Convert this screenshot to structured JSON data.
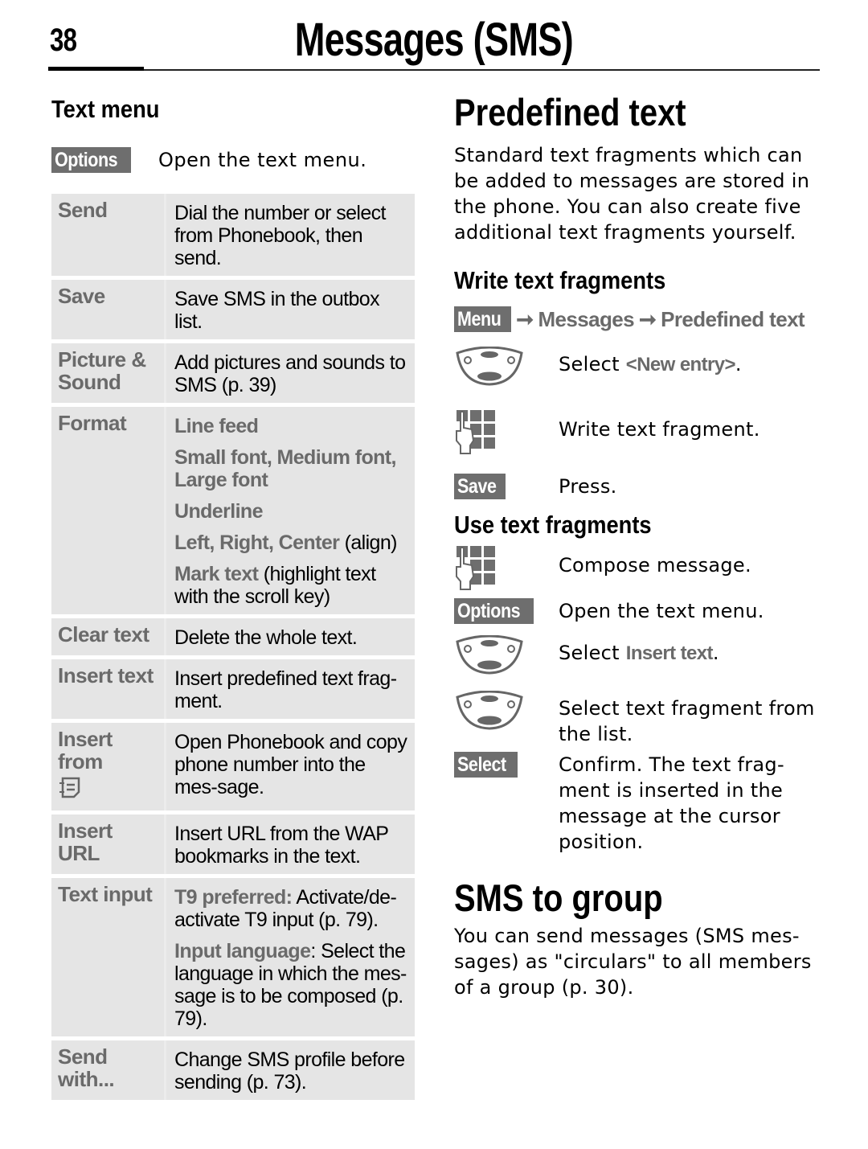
{
  "header": {
    "page_number": "38",
    "chapter_title": "Messages (SMS)"
  },
  "text_menu": {
    "heading": "Text menu",
    "intro": {
      "softkey": "Options",
      "icon": "options-softkey",
      "description": "Open the text menu."
    },
    "rows": [
      {
        "term": [
          "Send"
        ],
        "definition": [
          [
            {
              "t": "Dial the number or select from Phonebook, then send.",
              "hl": false
            }
          ]
        ]
      },
      {
        "term": [
          "Save"
        ],
        "definition": [
          [
            {
              "t": "Save SMS in the outbox list.",
              "hl": false
            }
          ]
        ]
      },
      {
        "term": [
          "Picture &",
          "Sound"
        ],
        "definition": [
          [
            {
              "t": "Add pictures and sounds to SMS (p. 39)",
              "hl": false
            }
          ]
        ]
      },
      {
        "term": [
          "Format"
        ],
        "definition": [
          [
            {
              "t": "Line feed",
              "hl": true
            }
          ],
          [
            {
              "t": "Small font, Medium font, Large font",
              "hl": true
            }
          ],
          [
            {
              "t": "Underline",
              "hl": true
            }
          ],
          [
            {
              "t": "Left, Right, Center",
              "hl": true
            },
            {
              "t": " (align)",
              "hl": false
            }
          ],
          [
            {
              "t": "Mark text",
              "hl": true
            },
            {
              "t": " (highlight text with the scroll key)",
              "hl": false
            }
          ]
        ]
      },
      {
        "term": [
          "Clear text"
        ],
        "definition": [
          [
            {
              "t": "Delete the whole text.",
              "hl": false
            }
          ]
        ]
      },
      {
        "term": [
          "Insert text"
        ],
        "definition": [
          [
            {
              "t": "Insert predefined text frag-ment.",
              "hl": false
            }
          ]
        ]
      },
      {
        "term": [
          "Insert from"
        ],
        "term_icon": "phonebook-icon",
        "definition": [
          [
            {
              "t": "Open Phonebook and copy phone number into the mes-sage.",
              "hl": false
            }
          ]
        ]
      },
      {
        "term": [
          "Insert URL"
        ],
        "definition": [
          [
            {
              "t": "Insert URL from the WAP bookmarks in the text.",
              "hl": false
            }
          ]
        ]
      },
      {
        "term": [
          "Text input"
        ],
        "definition": [
          [
            {
              "t": "T9 preferred:",
              "hl": true
            },
            {
              "t": " Activate/de-activate T9 input (p. 79).",
              "hl": false
            }
          ],
          [
            {
              "t": "Input language",
              "hl": true
            },
            {
              "t": ": Select the language in which the mes-sage is to be composed (p. 79).",
              "hl": false
            }
          ]
        ]
      },
      {
        "term": [
          "Send",
          "with..."
        ],
        "definition": [
          [
            {
              "t": "Change SMS profile before sending (p. 73).",
              "hl": false
            }
          ]
        ]
      }
    ]
  },
  "predefined_text": {
    "heading": "Predefined text",
    "intro": "Standard text fragments which can be added to messages are stored in the phone. You can also create five additional text fragments yourself.",
    "write": {
      "heading": "Write text fragments",
      "path": {
        "softkey": "Menu",
        "items": [
          "Messages",
          "Predefined text"
        ],
        "separator_icon": "arrow-right-icon"
      },
      "steps": [
        {
          "icon": "navigation-key-icon",
          "text": "Select ",
          "highlight": "<New entry>",
          "after": "."
        },
        {
          "icon": "keypad-icon",
          "text": "Write text fragment."
        },
        {
          "icon": "softkey",
          "softkey": "Save",
          "text": "Press."
        }
      ]
    },
    "use": {
      "heading": "Use text fragments",
      "steps": [
        {
          "icon": "keypad-icon",
          "text": "Compose message."
        },
        {
          "icon": "softkey",
          "softkey": "Options",
          "text": "Open the text menu."
        },
        {
          "icon": "navigation-key-icon",
          "text": "Select ",
          "highlight": "Insert text",
          "after": "."
        },
        {
          "icon": "navigation-key-icon",
          "text": "Select text fragment from the list."
        },
        {
          "icon": "softkey",
          "softkey": "Select",
          "text": "Confirm. The text frag-ment is inserted in the message at the cursor position."
        }
      ]
    }
  },
  "sms_to_group": {
    "heading": "SMS to group",
    "body": "You can send messages (SMS mes-sages) as \"circulars\" to all members of a group (p. 30)."
  },
  "colors": {
    "softkey_bg": "#6e6e6e",
    "highlight_text": "#6a6a6a",
    "table_bg": "#e5e5e5"
  }
}
